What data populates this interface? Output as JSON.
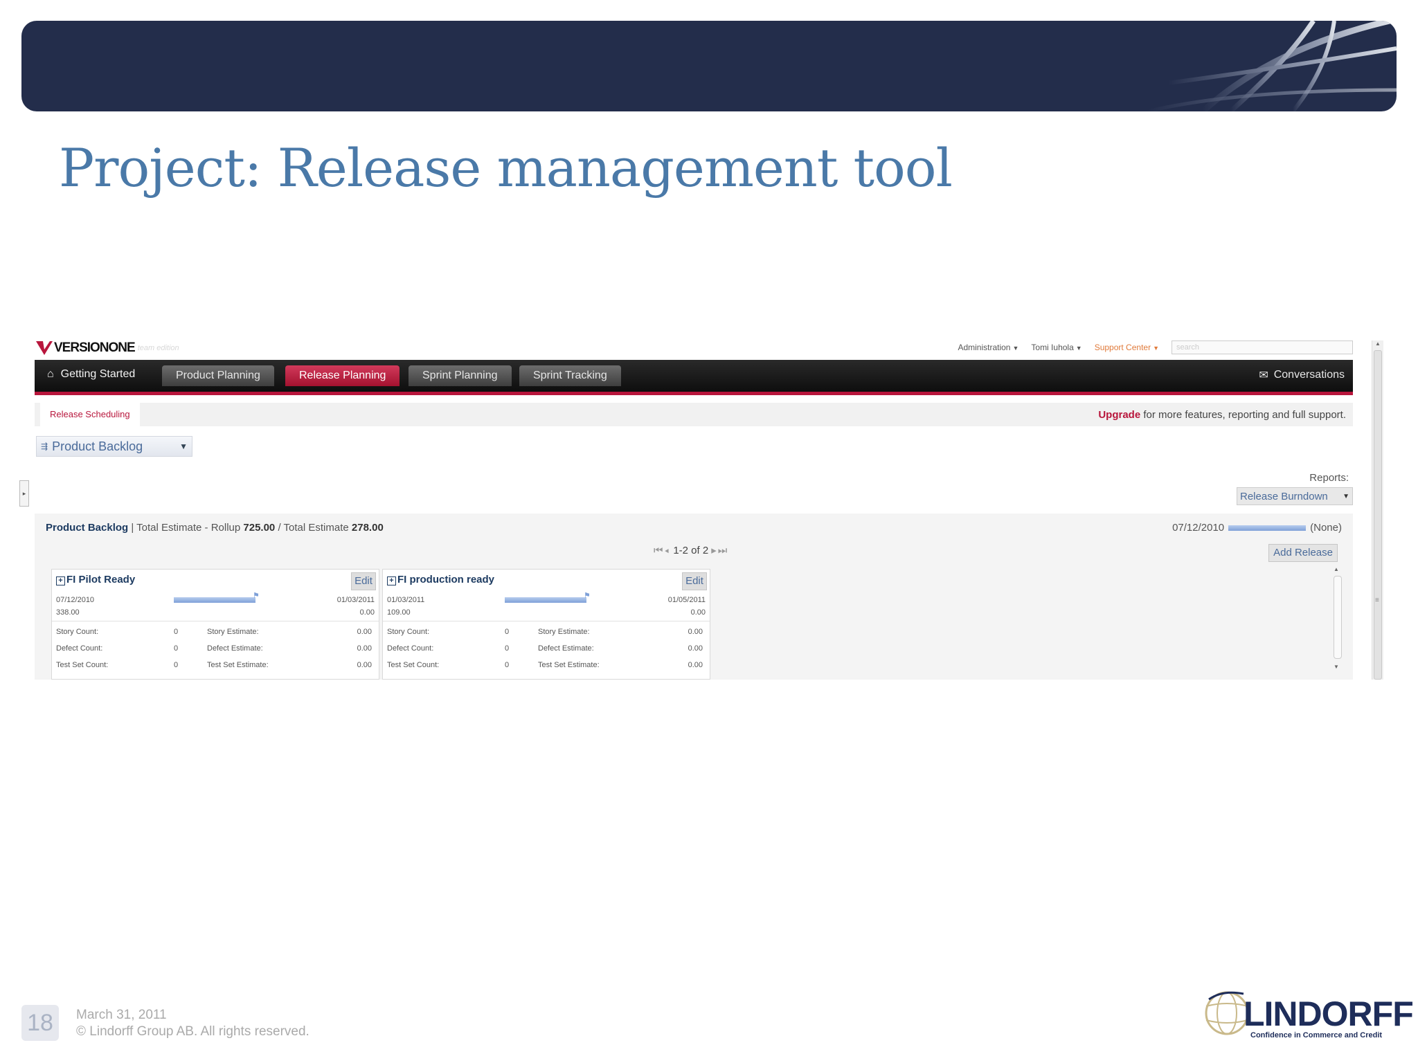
{
  "slide": {
    "title": "Project: Release management tool",
    "page_number": "18",
    "date": "March 31, 2011",
    "copyright": "© Lindorff Group AB. All rights reserved.",
    "brand_name": "LINDORFF",
    "brand_tagline": "Confidence in Commerce and Credit"
  },
  "app": {
    "logo_text": "VERSIONONE",
    "logo_sub": "team edition",
    "util": {
      "administration": "Administration",
      "user": "Tomi Iuhola",
      "support": "Support Center",
      "search_placeholder": "search"
    },
    "nav": {
      "home": "Getting Started",
      "tabs": [
        "Product Planning",
        "Release Planning",
        "Sprint Planning",
        "Sprint Tracking"
      ],
      "active_tab": "Release Planning",
      "conversations": "Conversations"
    },
    "subnav": {
      "tab": "Release Scheduling",
      "upgrade_bold": "Upgrade",
      "upgrade_rest": " for more features, reporting and full support."
    },
    "backlog_select": "Product Backlog",
    "reports": {
      "label": "Reports:",
      "selected": "Release Burndown"
    },
    "panel": {
      "title": "Product Backlog",
      "rollup_label": "Total Estimate - Rollup",
      "rollup_value": "725.00",
      "total_label": "Total Estimate",
      "total_value": "278.00",
      "date": "07/12/2010",
      "none_label": "(None)",
      "pager": "1-2 of 2",
      "add_release": "Add Release"
    },
    "cards": [
      {
        "title": "FI Pilot Ready",
        "edit": "Edit",
        "start_date": "07/12/2010",
        "end_date": "01/03/2011",
        "sum_left": "338.00",
        "sum_right": "0.00",
        "stats": [
          {
            "label": "Story Count:",
            "value": "0",
            "est_label": "Story Estimate:",
            "est_value": "0.00"
          },
          {
            "label": "Defect Count:",
            "value": "0",
            "est_label": "Defect Estimate:",
            "est_value": "0.00"
          },
          {
            "label": "Test Set Count:",
            "value": "0",
            "est_label": "Test Set Estimate:",
            "est_value": "0.00"
          }
        ]
      },
      {
        "title": "FI production ready",
        "edit": "Edit",
        "start_date": "01/03/2011",
        "end_date": "01/05/2011",
        "sum_left": "109.00",
        "sum_right": "0.00",
        "stats": [
          {
            "label": "Story Count:",
            "value": "0",
            "est_label": "Story Estimate:",
            "est_value": "0.00"
          },
          {
            "label": "Defect Count:",
            "value": "0",
            "est_label": "Defect Estimate:",
            "est_value": "0.00"
          },
          {
            "label": "Test Set Count:",
            "value": "0",
            "est_label": "Test Set Estimate:",
            "est_value": "0.00"
          }
        ]
      }
    ]
  },
  "colors": {
    "banner": "#232d4b",
    "title": "#4a79a8",
    "accent": "#b8163c",
    "brand": "#1e2d5a"
  }
}
